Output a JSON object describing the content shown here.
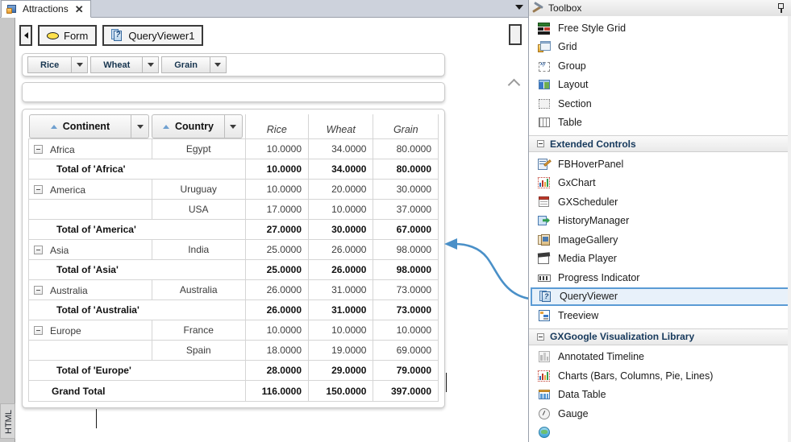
{
  "window": {
    "tab": {
      "label": "Attractions",
      "icon": "knowledge-base-icon",
      "close": "✕"
    },
    "tabbar_dropdown_icon": "chevron-down-icon"
  },
  "left_strip": {
    "tab_label": "HTML"
  },
  "breadcrumb": {
    "prev_icon": "triangle-left-icon",
    "next_icon": "triangle-right-icon",
    "items": [
      {
        "label": "Form",
        "icon": "form-oval-icon"
      },
      {
        "label": "QueryViewer1",
        "icon": "queryviewer-icon"
      }
    ]
  },
  "canvas": {
    "scroll_up_icon": "chevron-up-icon"
  },
  "queryviewer": {
    "measure_chips": [
      {
        "label": "Rice",
        "dropdown_icon": "caret-down-icon"
      },
      {
        "label": "Wheat",
        "dropdown_icon": "caret-down-icon"
      },
      {
        "label": "Grain",
        "dropdown_icon": "caret-down-icon"
      }
    ],
    "dropbar_placeholder": "",
    "dimension_headers": [
      {
        "label": "Continent",
        "sort": "ascending",
        "sort_icon": "sort-asc-icon",
        "dropdown_icon": "caret-down-icon"
      },
      {
        "label": "Country",
        "sort": "ascending",
        "sort_icon": "sort-asc-icon",
        "dropdown_icon": "caret-down-icon"
      }
    ],
    "measure_headers": [
      "Rice",
      "Wheat",
      "Grain"
    ],
    "expander_icon": "collapse-box-icon",
    "rows": [
      {
        "type": "data",
        "continent": "Africa",
        "country": "Egypt",
        "values": [
          "10.0000",
          "34.0000",
          "80.0000"
        ],
        "first_of_group": true
      },
      {
        "type": "total",
        "label": "Total of 'Africa'",
        "values": [
          "10.0000",
          "34.0000",
          "80.0000"
        ]
      },
      {
        "type": "data",
        "continent": "America",
        "country": "Uruguay",
        "values": [
          "10.0000",
          "20.0000",
          "30.0000"
        ],
        "first_of_group": true
      },
      {
        "type": "data",
        "continent": "",
        "country": "USA",
        "values": [
          "17.0000",
          "10.0000",
          "37.0000"
        ],
        "first_of_group": false
      },
      {
        "type": "total",
        "label": "Total of 'America'",
        "values": [
          "27.0000",
          "30.0000",
          "67.0000"
        ]
      },
      {
        "type": "data",
        "continent": "Asia",
        "country": "India",
        "values": [
          "25.0000",
          "26.0000",
          "98.0000"
        ],
        "first_of_group": true
      },
      {
        "type": "total",
        "label": "Total of 'Asia'",
        "values": [
          "25.0000",
          "26.0000",
          "98.0000"
        ]
      },
      {
        "type": "data",
        "continent": "Australia",
        "country": "Australia",
        "values": [
          "26.0000",
          "31.0000",
          "73.0000"
        ],
        "first_of_group": true
      },
      {
        "type": "total",
        "label": "Total of 'Australia'",
        "values": [
          "26.0000",
          "31.0000",
          "73.0000"
        ]
      },
      {
        "type": "data",
        "continent": "Europe",
        "country": "France",
        "values": [
          "10.0000",
          "10.0000",
          "10.0000"
        ],
        "first_of_group": true
      },
      {
        "type": "data",
        "continent": "",
        "country": "Spain",
        "values": [
          "18.0000",
          "19.0000",
          "69.0000"
        ],
        "first_of_group": false
      },
      {
        "type": "total",
        "label": "Total of 'Europe'",
        "values": [
          "28.0000",
          "29.0000",
          "79.0000"
        ]
      },
      {
        "type": "grand",
        "label": "Grand Total",
        "values": [
          "116.0000",
          "150.0000",
          "397.0000"
        ]
      }
    ]
  },
  "annotation": {
    "arrow_color": "#4a90c8",
    "arrow_icon": "curved-arrow-icon"
  },
  "toolbox": {
    "title": "Toolbox",
    "title_icon": "hammer-wrench-icon",
    "pin_icon": "pin-icon",
    "top_items": [
      {
        "label": "Free Style Grid",
        "icon": "free-style-grid-icon",
        "cls": "ic-fsg",
        "parts": [
          "r1",
          "r2",
          "r3",
          "r4"
        ]
      },
      {
        "label": "Grid",
        "icon": "grid-icon",
        "cls": "ic-grid",
        "parts": [
          "g3",
          "g1",
          "g2"
        ]
      },
      {
        "label": "Group",
        "icon": "group-icon",
        "cls": "ic-group",
        "parts": [
          "b"
        ],
        "text": "xy"
      },
      {
        "label": "Layout",
        "icon": "layout-icon",
        "cls": "ic-layout",
        "parts": [
          "o",
          "hdr",
          "c1",
          "c2"
        ]
      },
      {
        "label": "Section",
        "icon": "section-icon",
        "cls": "ic-section",
        "parts": [
          "s"
        ]
      },
      {
        "label": "Table",
        "icon": "table-icon",
        "cls": "ic-table",
        "parts": [
          "t"
        ]
      }
    ],
    "groups": [
      {
        "title": "Extended Controls",
        "toggle_icon": "collapse-box-icon",
        "items": [
          {
            "label": "FBHoverPanel",
            "icon": "fbhoverpanel-icon",
            "cls": "ic-fbhover",
            "parts": [
              "p",
              "l1",
              "l2",
              "pen"
            ],
            "selected": false
          },
          {
            "label": "GxChart",
            "icon": "gxchart-icon",
            "cls": "ic-chart",
            "parts": [
              "bg",
              "b1",
              "b2",
              "b3",
              "b4"
            ],
            "selected": false
          },
          {
            "label": "GXScheduler",
            "icon": "gxscheduler-icon",
            "cls": "ic-sched",
            "parts": [
              "p",
              "top",
              "l1",
              "l2"
            ],
            "selected": false
          },
          {
            "label": "HistoryManager",
            "icon": "historymanager-icon",
            "cls": "ic-hist",
            "parts": [
              "b",
              "a"
            ],
            "selected": false
          },
          {
            "label": "ImageGallery",
            "icon": "imagegallery-icon",
            "cls": "ic-gallery",
            "parts": [
              "f1",
              "f2",
              "im"
            ],
            "selected": false
          },
          {
            "label": "Media Player",
            "icon": "media-player-icon",
            "cls": "ic-media",
            "parts": [
              "b",
              "cl"
            ],
            "selected": false
          },
          {
            "label": "Progress Indicator",
            "icon": "progress-indicator-icon",
            "cls": "ic-prog",
            "parts": [
              "o",
              "f"
            ],
            "selected": false
          },
          {
            "label": "QueryViewer",
            "icon": "queryviewer-icon",
            "cls": "ic-qv",
            "parts": [
              "p1",
              "p2"
            ],
            "text": "?",
            "selected": true
          },
          {
            "label": "Treeview",
            "icon": "treeview-icon",
            "cls": "ic-tree",
            "parts": [
              "o",
              "r1",
              "r2",
              "r3"
            ],
            "selected": false
          }
        ]
      },
      {
        "title": "GXGoogle Visualization Library",
        "toggle_icon": "collapse-box-icon",
        "items": [
          {
            "label": "Annotated Timeline",
            "icon": "annotated-timeline-icon",
            "cls": "ic-timeline",
            "parts": [
              "o",
              "b1",
              "b2",
              "b3"
            ],
            "selected": false
          },
          {
            "label": "Charts (Bars, Columns, Pie, Lines)",
            "icon": "charts-icon",
            "cls": "ic-chart",
            "parts": [
              "bg",
              "b1",
              "b2",
              "b3",
              "b4"
            ],
            "selected": false
          },
          {
            "label": "Data Table",
            "icon": "data-table-icon",
            "cls": "ic-dtable",
            "parts": [
              "o",
              "hd",
              "c1",
              "c2",
              "c3"
            ],
            "selected": false
          },
          {
            "label": "Gauge",
            "icon": "gauge-icon",
            "cls": "ic-gauge",
            "parts": [
              "o",
              "n"
            ],
            "selected": false
          },
          {
            "label": "",
            "icon": "globe-map-icon",
            "cls": "ic-globe",
            "parts": [
              "o",
              "l"
            ],
            "selected": false
          }
        ]
      }
    ]
  }
}
